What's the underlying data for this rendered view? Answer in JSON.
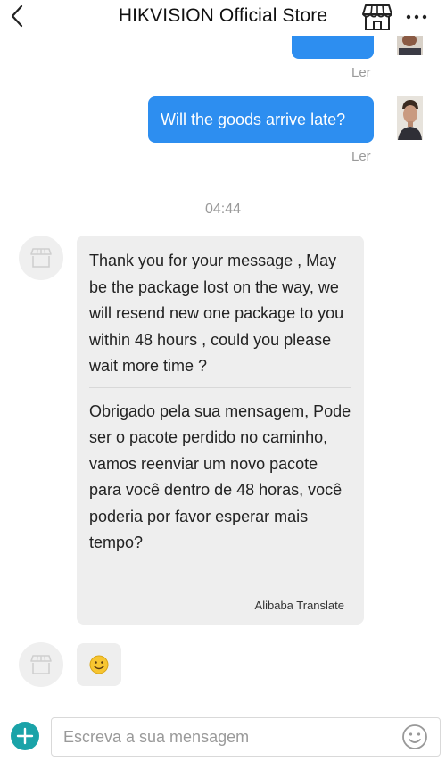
{
  "header": {
    "title": "HIKVISION Official Store",
    "back_icon": "chevron-left-icon",
    "store_icon": "storefront-icon",
    "more_icon": "more-dots-icon"
  },
  "chat": {
    "previous_status": "Ler",
    "question": {
      "text": "Will the goods arrive late?",
      "status": "Ler"
    },
    "timestamp": "04:44",
    "reply": {
      "original": "Thank you for your message , May be the package lost on the way, we will resend new one package to you within 48 hours , could you please wait more time ?",
      "translated": "Obrigado pela sua mensagem, Pode ser o pacote perdido no caminho, vamos reenviar um novo pacote para você dentro de 48 horas, você poderia por favor esperar mais tempo?",
      "translation_credit": "Alibaba Translate"
    },
    "emoji_message": "smiley-emoji-icon"
  },
  "composer": {
    "placeholder": "Escreva a sua mensagem",
    "add_icon": "plus-icon",
    "emoji_icon": "smiley-icon"
  },
  "colors": {
    "outgoing_bubble": "#2d8ef0",
    "incoming_bubble": "#eeeeee",
    "plus_button": "#1aa3a8",
    "muted_text": "#9a9a9a"
  }
}
